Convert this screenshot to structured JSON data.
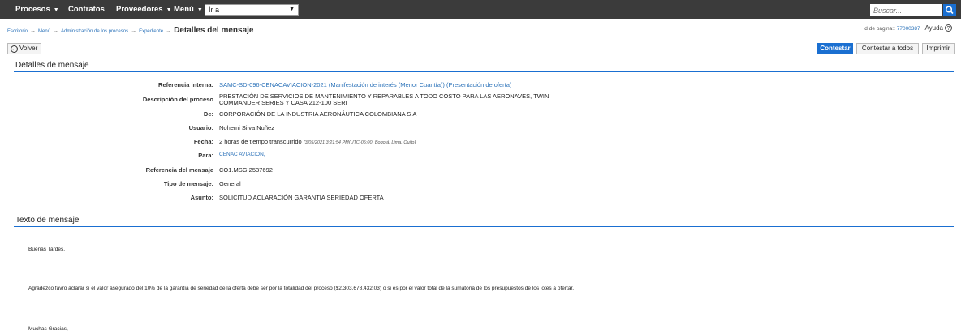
{
  "nav": {
    "items": [
      "Procesos",
      "Contratos",
      "Proveedores",
      "Menú"
    ],
    "goto_value": "Ir a",
    "search_placeholder": "Buscar..."
  },
  "breadcrumb": {
    "items": [
      "Escritorio",
      "Menú",
      "Administración de los procesos",
      "Expediente"
    ],
    "current": "Detalles del mensaje",
    "page_id_label": "Id de página::",
    "page_id": "77000387",
    "help": "Ayuda"
  },
  "toolbar": {
    "back": "Volver",
    "reply": "Contestar",
    "reply_all": "Contestar a todos",
    "print": "Imprimir"
  },
  "details": {
    "title": "Detalles de mensaje",
    "labels": {
      "ref_interna": "Referencia interna:",
      "descripcion": "Descripción del proceso",
      "de": "De:",
      "usuario": "Usuario:",
      "fecha": "Fecha:",
      "para": "Para:",
      "ref_mensaje": "Referencia del mensaje",
      "tipo": "Tipo de mensaje:",
      "asunto": "Asunto:"
    },
    "values": {
      "ref_interna": "SAMC-SD-096-CENACAVIACION-2021 (Manifestación de interés (Menor Cuantía)) (Presentación de oferta)",
      "descripcion_1": "PRESTACIÓN DE SERVICIOS DE MANTENIMIENTO Y REPARABLES A TODO COSTO PARA LAS AERONAVES, TWIN",
      "descripcion_2": "COMMANDER SERIES Y CASA 212-100 SERI",
      "de": "CORPORACIÓN DE LA INDUSTRIA AERONÁUTICA COLOMBIANA S.A",
      "usuario": "Nohemi Silva Nuñez",
      "fecha": "2 horas de tiempo transcurrido",
      "fecha_note": "(3/05/2021 3:21:54 PM(UTC-05:00) Bogotá, Lima, Quito)",
      "para": "CENAC AVIACION,",
      "ref_mensaje": "CO1.MSG.2537692",
      "tipo": "General",
      "asunto": "SOLICITUD ACLARACIÓN GARANTIA SERIEDAD OFERTA"
    }
  },
  "message": {
    "title": "Texto de mensaje",
    "line1": "Buenas Tardes,",
    "line2": "Agradezco favro aclarar si el valor asegurado del 10% de la garantía de seriedad de la oferta debe ser por la totalidad del proceso ($2.303.678.432,03) o si es por el valor total de la sumatoria de los presupuestos de los lotes a ofertar.",
    "line3": "Muchas Gracias,"
  }
}
